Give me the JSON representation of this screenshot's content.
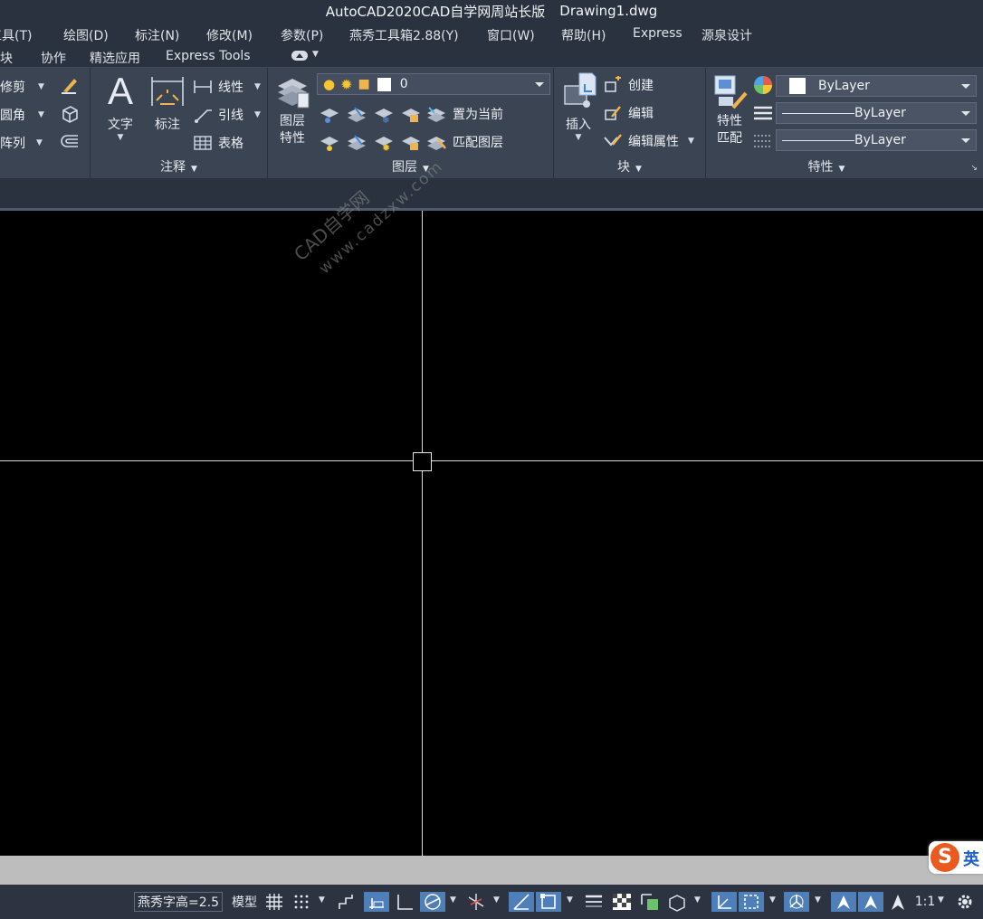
{
  "title": {
    "app": "AutoCAD2020CAD自学网周站长版",
    "file": "Drawing1.dwg"
  },
  "menu": [
    "工具(T)",
    "绘图(D)",
    "标注(N)",
    "修改(M)",
    "参数(P)",
    "燕秀工具箱2.88(Y)",
    "窗口(W)",
    "帮助(H)",
    "Express",
    "源泉设计"
  ],
  "tabs": [
    "模块",
    "协作",
    "精选应用",
    "Express Tools"
  ],
  "ribbon": {
    "modify": {
      "trim": "修剪",
      "fillet": "圆角",
      "array": "阵列"
    },
    "annotation": {
      "title": "注释",
      "text": "文字",
      "dimension": "标注",
      "linear": "线性",
      "leader": "引线",
      "table": "表格"
    },
    "layers": {
      "title": "图层",
      "properties_1": "图层",
      "properties_2": "特性",
      "current_layer": "0",
      "set_current": "置为当前",
      "match_layer": "匹配图层"
    },
    "block": {
      "title": "块",
      "insert": "插入",
      "create": "创建",
      "edit": "编辑",
      "edit_attributes": "编辑属性"
    },
    "properties": {
      "title": "特性",
      "match_1": "特性",
      "match_2": "匹配",
      "color": "ByLayer",
      "linetype": "ByLayer",
      "lineweight": "ByLayer"
    }
  },
  "watermark": {
    "line1": "CAD自学网",
    "line2": "www.cadzxw.com"
  },
  "ime": {
    "mode": "英"
  },
  "status": {
    "text_height": "燕秀字高=2.5",
    "model": "模型",
    "scale": "1:1"
  },
  "colors": {
    "ribbon_bg": "#3b4453",
    "title_bg": "#2b323f",
    "canvas_bg": "#000000",
    "status_on": "#4f7fb8"
  }
}
